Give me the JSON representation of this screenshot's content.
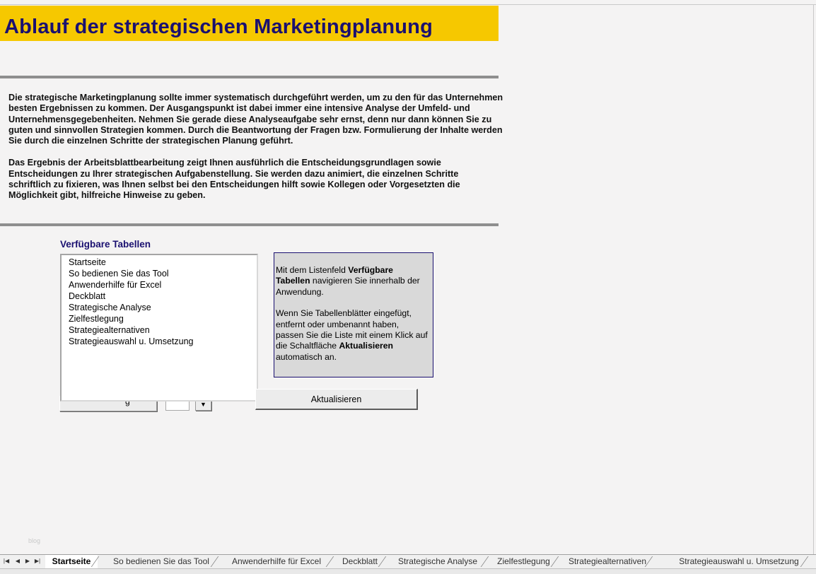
{
  "title": "Ablauf der strategischen Marketingplanung",
  "intro": {
    "paragraph1": "Die strategische  Marketingplanung sollte  immer systematisch  durchgeführt werden, um zu den für das Unternehmen besten Ergebnissen  zu kommen. Der Ausgangspunkt  ist dabei immer eine intensive Analyse der Umfeld- und Unternehmensgegebenheiten. Nehmen Sie gerade diese Analyseaufgabe sehr ernst, denn nur dann können Sie zu guten und sinnvollen  Strategien kommen. Durch die Beantwortung der Fragen bzw. Formulierung der Inhalte werden Sie durch die einzelnen Schritte der strategischen  Planung geführt.",
    "paragraph2": "Das Ergebnis  der Arbeitsblattbearbeitung zeigt Ihnen ausführlich die Entscheidungsgrundlagen  sowie Entscheidungen  zu Ihrer strategischen  Aufgabenstellung.  Sie werden dazu animiert, die einzelnen Schritte schriftlich  zu fixieren, was Ihnen selbst  bei den Entscheidungen  hilft sowie Kollegen oder Vorgesetzten die Möglichkeit gibt, hilfreiche Hinweise zu geben."
  },
  "list": {
    "label": "Verfügbare Tabellen",
    "items": [
      "Startseite",
      "So bedienen Sie das Tool",
      "Anwenderhilfe für Excel",
      "Deckblatt",
      "Strategische Analyse",
      "Zielfestlegung",
      "Strategiealternativen",
      "Strategieauswahl u. Umsetzung"
    ]
  },
  "info": {
    "line1_pre": "Mit dem Listenfeld ",
    "line1_bold": "Verfügbare Tabellen",
    "line1_post": " navigieren  Sie innerhalb der Anwendung.",
    "line2_pre": "Wenn Sie Tabellenblätter  eingefügt, entfernt  oder umbenannt  haben, passen Sie die Liste mit einem Klick auf die Schaltfläche ",
    "line2_bold": "Aktualisieren",
    "line2_post": " automatisch an."
  },
  "hidden_button_label": "g",
  "update_button": "Aktualisieren",
  "watermark": "blog",
  "sheet_tabs": {
    "active": "Startseite",
    "items": [
      "Startseite",
      "So bedienen Sie das Tool",
      "Anwenderhilfe für Excel",
      "Deckblatt",
      "Strategische Analyse",
      "Zielfestlegung",
      "Strategiealternativen",
      "Strategieauswahl u. Umsetzung"
    ]
  },
  "colors": {
    "title_band": "#f6c800",
    "title_text": "#1a1070",
    "rule": "#8e8e8e",
    "info_bg": "#d9d9d9"
  }
}
